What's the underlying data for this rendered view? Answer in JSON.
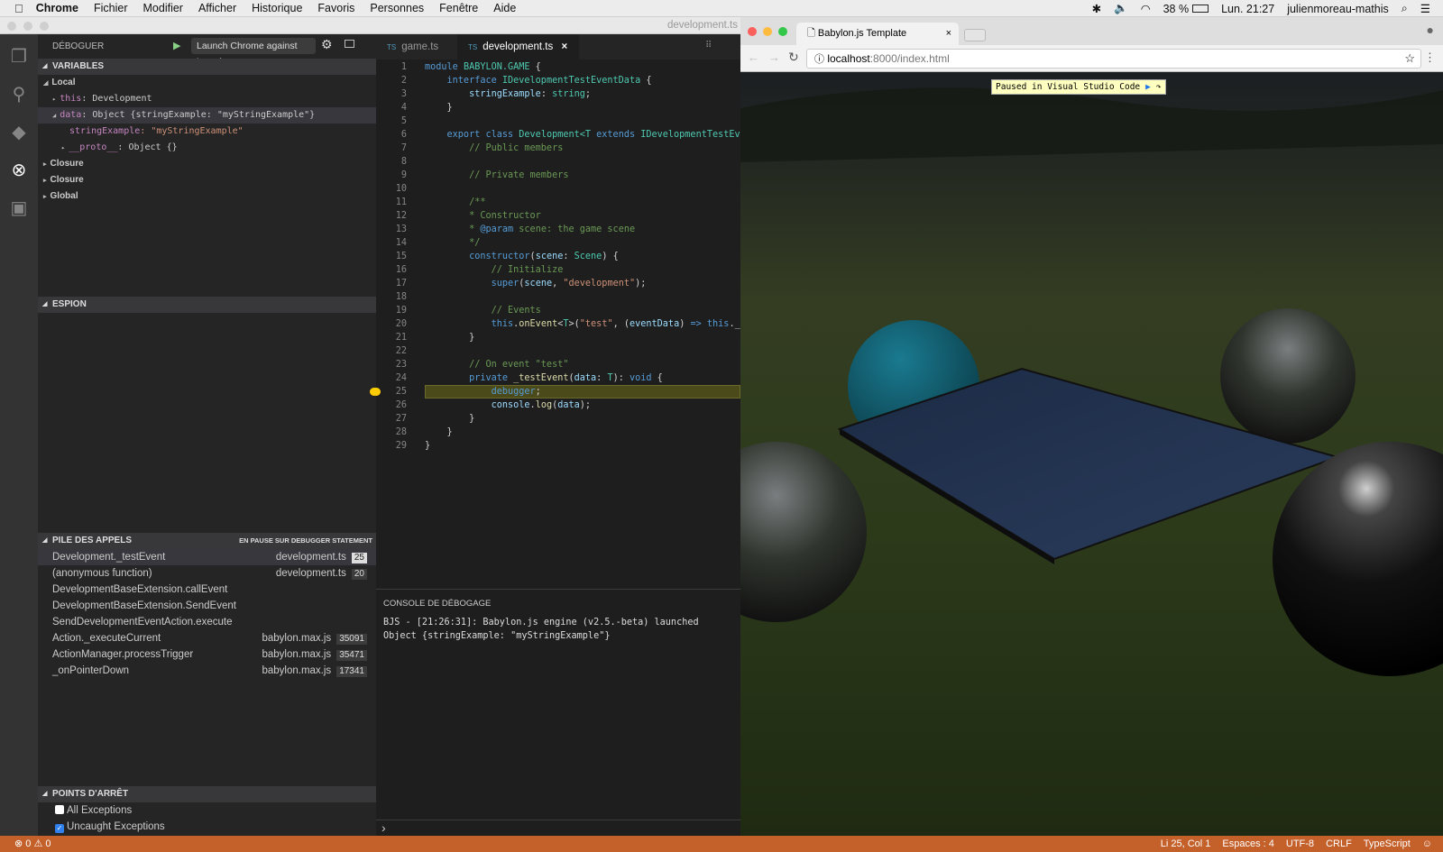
{
  "menubar": {
    "app": "Chrome",
    "items": [
      "Fichier",
      "Modifier",
      "Afficher",
      "Historique",
      "Favoris",
      "Personnes",
      "Fenêtre",
      "Aide"
    ],
    "battery": "38 %",
    "clock": "Lun. 21:27",
    "user": "julienmoreau-mathis"
  },
  "vscode": {
    "window_title": "development.ts",
    "sidebar": {
      "title": "DÉBOGUER",
      "launch_config": "Launch Chrome against loca",
      "variables": {
        "title": "VARIABLES",
        "local": "Local",
        "items": [
          {
            "key": "this",
            "value": ": Development"
          },
          {
            "key": "data",
            "value": ": Object {stringExample: \"myStringExample\"}"
          },
          {
            "key": "stringExample",
            "value": ": \"myStringExample\""
          },
          {
            "key": "__proto__",
            "value": ": Object {}"
          }
        ],
        "scopes": [
          "Closure",
          "Closure",
          "Global"
        ]
      },
      "watch": {
        "title": "ESPION"
      },
      "callstack": {
        "title": "PILE DES APPELS",
        "status": "EN PAUSE SUR DEBUGGER STATEMENT",
        "frames": [
          {
            "name": "Development._testEvent",
            "file": "development.ts",
            "line": "25"
          },
          {
            "name": "(anonymous function)",
            "file": "development.ts",
            "line": "20"
          },
          {
            "name": "DevelopmentBaseExtension.callEvent",
            "file": "",
            "line": ""
          },
          {
            "name": "DevelopmentBaseExtension.SendEvent",
            "file": "",
            "line": ""
          },
          {
            "name": "SendDevelopmentEventAction.execute",
            "file": "",
            "line": ""
          },
          {
            "name": "Action._executeCurrent",
            "file": "babylon.max.js",
            "line": "35091"
          },
          {
            "name": "ActionManager.processTrigger",
            "file": "babylon.max.js",
            "line": "35471"
          },
          {
            "name": "_onPointerDown",
            "file": "babylon.max.js",
            "line": "17341"
          }
        ]
      },
      "breakpoints": {
        "title": "POINTS D'ARRÊT",
        "items": [
          {
            "label": "All Exceptions",
            "checked": false
          },
          {
            "label": "Uncaught Exceptions",
            "checked": true
          }
        ]
      }
    },
    "tabs": [
      {
        "label": "game.ts",
        "badge": "TS"
      },
      {
        "label": "development.ts",
        "badge": "TS",
        "close": "×"
      }
    ],
    "current_line": 25,
    "code": [
      [
        [
          "module ",
          "kw"
        ],
        [
          "BABYLON.GAME ",
          "ty"
        ],
        [
          "{",
          "pl"
        ]
      ],
      [
        [
          "    interface ",
          "kw"
        ],
        [
          "IDevelopmentTestEventData ",
          "ty"
        ],
        [
          "{",
          "pl"
        ]
      ],
      [
        [
          "        stringExample",
          "vr"
        ],
        [
          ": ",
          "pl"
        ],
        [
          "string",
          "ty"
        ],
        [
          ";",
          "pl"
        ]
      ],
      [
        [
          "    }",
          "pl"
        ]
      ],
      [],
      [
        [
          "    export ",
          "kw"
        ],
        [
          "class ",
          "kw"
        ],
        [
          "Development",
          "ty"
        ],
        [
          "<T ",
          "ty"
        ],
        [
          "extends ",
          "kw"
        ],
        [
          "IDevelopmentTestEve",
          "ty"
        ]
      ],
      [
        [
          "        // Public members",
          "cm"
        ]
      ],
      [],
      [
        [
          "        // Private members",
          "cm"
        ]
      ],
      [],
      [
        [
          "        /**",
          "cm"
        ]
      ],
      [
        [
          "        * Constructor",
          "cm"
        ]
      ],
      [
        [
          "        * ",
          "cm"
        ],
        [
          "@param",
          "kw"
        ],
        [
          " scene: the game scene",
          "cm"
        ]
      ],
      [
        [
          "        */",
          "cm"
        ]
      ],
      [
        [
          "        constructor",
          "kw"
        ],
        [
          "(",
          "pl"
        ],
        [
          "scene",
          "vr"
        ],
        [
          ": ",
          "pl"
        ],
        [
          "Scene",
          "ty"
        ],
        [
          ") {",
          "pl"
        ]
      ],
      [
        [
          "            // Initialize",
          "cm"
        ]
      ],
      [
        [
          "            super",
          "kw"
        ],
        [
          "(",
          "pl"
        ],
        [
          "scene",
          "vr"
        ],
        [
          ", ",
          "pl"
        ],
        [
          "\"development\"",
          "st"
        ],
        [
          ");",
          "pl"
        ]
      ],
      [],
      [
        [
          "            // Events",
          "cm"
        ]
      ],
      [
        [
          "            this",
          "kw"
        ],
        [
          ".",
          "pl"
        ],
        [
          "onEvent",
          "fn"
        ],
        [
          "<",
          "pl"
        ],
        [
          "T",
          "ty"
        ],
        [
          ">(",
          "pl"
        ],
        [
          "\"test\"",
          "st"
        ],
        [
          ", (",
          "pl"
        ],
        [
          "eventData",
          "vr"
        ],
        [
          ") ",
          "pl"
        ],
        [
          "=> ",
          "kw"
        ],
        [
          "this",
          "kw"
        ],
        [
          "._t",
          "pl"
        ]
      ],
      [
        [
          "        }",
          "pl"
        ]
      ],
      [],
      [
        [
          "        // On event \"test\"",
          "cm"
        ]
      ],
      [
        [
          "        private ",
          "kw"
        ],
        [
          "_testEvent",
          "fn"
        ],
        [
          "(",
          "pl"
        ],
        [
          "data",
          "vr"
        ],
        [
          ": ",
          "pl"
        ],
        [
          "T",
          "ty"
        ],
        [
          "): ",
          "pl"
        ],
        [
          "void ",
          "kw"
        ],
        [
          "{",
          "pl"
        ]
      ],
      [
        [
          "            debugger",
          "kw"
        ],
        [
          ";",
          "pl"
        ]
      ],
      [
        [
          "            console",
          "vr"
        ],
        [
          ".",
          "pl"
        ],
        [
          "log",
          "fn"
        ],
        [
          "(",
          "pl"
        ],
        [
          "data",
          "vr"
        ],
        [
          ");",
          "pl"
        ]
      ],
      [
        [
          "        }",
          "pl"
        ]
      ],
      [
        [
          "    }",
          "pl"
        ]
      ],
      [
        [
          "}",
          "pl"
        ]
      ]
    ],
    "console": {
      "title": "CONSOLE DE DÉBOGAGE",
      "lines": [
        "BJS - [21:26:31]: Babylon.js engine (v2.5.-beta) launched",
        "Object {stringExample: \"myStringExample\"}"
      ],
      "prompt": "›"
    },
    "status": {
      "errors": "0",
      "warnings": "0",
      "position": "Li 25, Col 1",
      "indent": "Espaces : 4",
      "encoding": "UTF-8",
      "eol": "CRLF",
      "language": "TypeScript"
    }
  },
  "chrome": {
    "tab_title": "Babylon.js Template",
    "tab_close": "×",
    "url_host": "localhost",
    "url_rest": ":8000/index.html",
    "paused_banner": "Paused in Visual Studio Code"
  },
  "colors": {
    "statusbar": "#c4602a",
    "current_line": "#4b4a1a",
    "breakpoint": "#ffcc00"
  }
}
